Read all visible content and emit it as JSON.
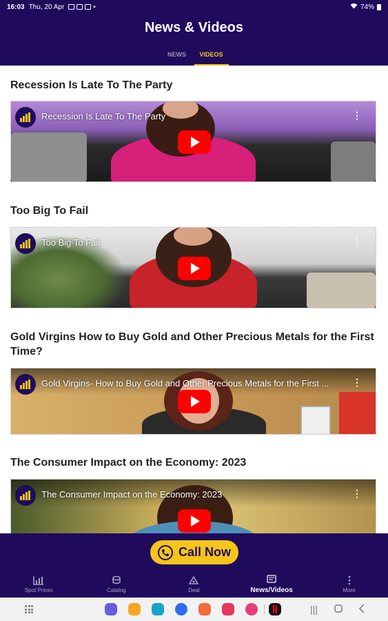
{
  "status_bar": {
    "time": "16:03",
    "date": "Thu, 20 Apr",
    "battery": "74%"
  },
  "header": {
    "title": "News & Videos",
    "tabs": [
      {
        "label": "NEWS",
        "active": false
      },
      {
        "label": "VIDEOS",
        "active": true
      }
    ]
  },
  "videos": [
    {
      "title": "Recession Is Late To The Party",
      "player_title": "Recession Is Late To The Party"
    },
    {
      "title": "Too Big To Fail",
      "player_title": "Too Big To Fail"
    },
    {
      "title": "Gold Virgins  How to Buy Gold and Other Precious Metals for the First Time?",
      "player_title": "Gold Virgins- How to Buy Gold and Other Precious Metals for the First ..."
    },
    {
      "title": "The Consumer Impact on the Economy: 2023",
      "player_title": "The Consumer Impact on the Economy: 2023"
    }
  ],
  "call_button": {
    "label": "Call Now"
  },
  "bottom_nav": [
    {
      "label": "Spot Prices",
      "icon": "chart-icon",
      "active": false
    },
    {
      "label": "Catalog",
      "icon": "coins-icon",
      "active": false
    },
    {
      "label": "Deal",
      "icon": "deal-icon",
      "active": false
    },
    {
      "label": "News/Videos",
      "icon": "news-icon",
      "active": true
    },
    {
      "label": "More",
      "icon": "more-icon",
      "active": false
    }
  ],
  "colors": {
    "brand": "#1f0a5c",
    "accent": "#f5c518",
    "play": "#ff0000"
  }
}
